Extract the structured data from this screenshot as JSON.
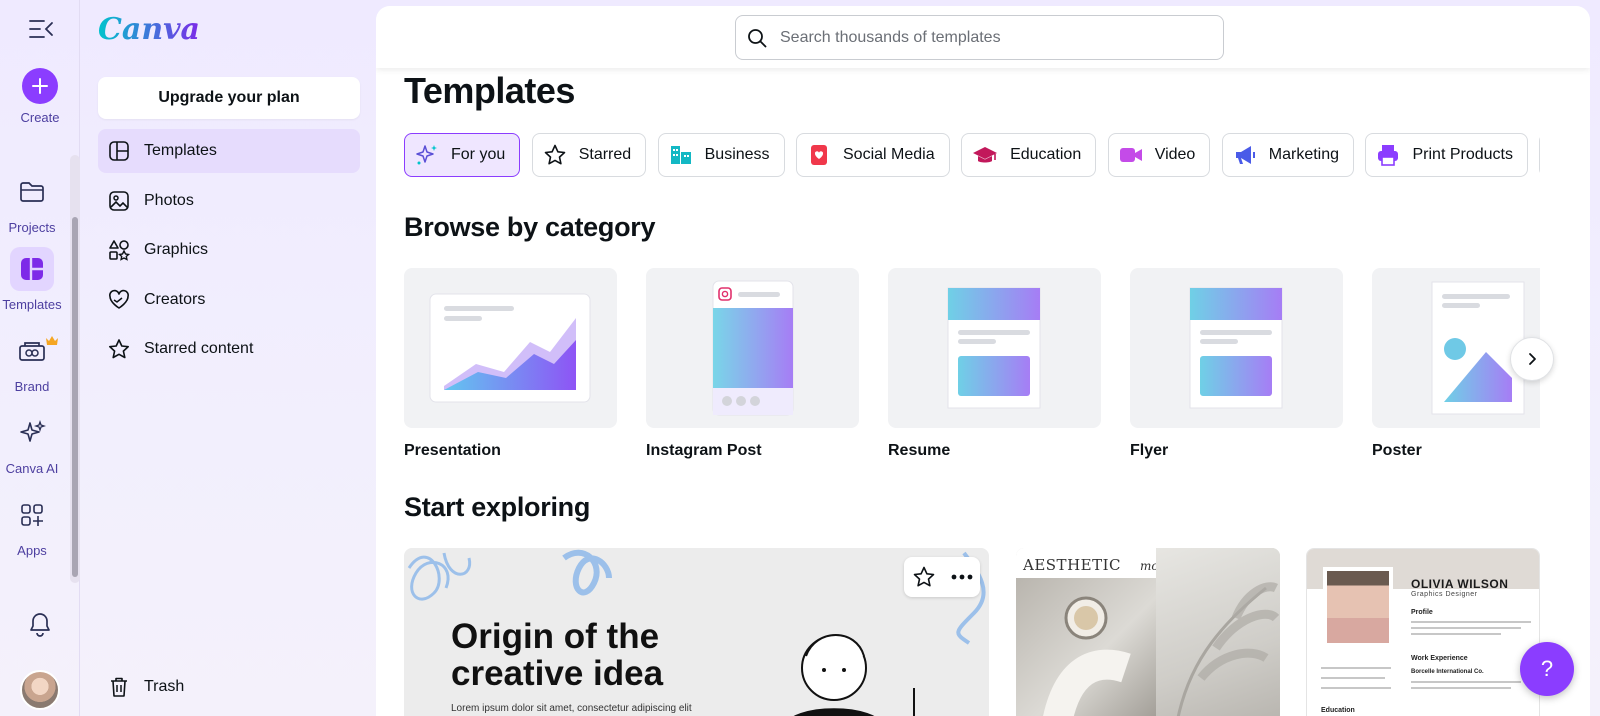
{
  "brand": {
    "logo_text": "Canva",
    "accent": "#8b3dff"
  },
  "rail": {
    "create_label": "Create",
    "items": [
      {
        "label": "Projects",
        "icon": "folder-icon"
      },
      {
        "label": "Templates",
        "icon": "templates-icon",
        "active": true
      },
      {
        "label": "Brand",
        "icon": "brand-icon",
        "badge": "crown-icon"
      },
      {
        "label": "Canva AI",
        "icon": "sparkle-icon"
      },
      {
        "label": "Apps",
        "icon": "apps-icon"
      }
    ]
  },
  "sidebar": {
    "upgrade_label": "Upgrade your plan",
    "items": [
      {
        "label": "Templates",
        "icon": "templates-icon",
        "active": true
      },
      {
        "label": "Photos",
        "icon": "photo-icon"
      },
      {
        "label": "Graphics",
        "icon": "graphics-icon"
      },
      {
        "label": "Creators",
        "icon": "heart-hands-icon"
      },
      {
        "label": "Starred content",
        "icon": "star-icon"
      }
    ],
    "trash_label": "Trash"
  },
  "search": {
    "placeholder": "Search thousands of templates"
  },
  "page": {
    "title": "Templates",
    "browse_heading": "Browse by category",
    "explore_heading": "Start exploring"
  },
  "chips": [
    {
      "label": "For you",
      "icon": "sparkle-icon",
      "active": true
    },
    {
      "label": "Starred",
      "icon": "star-icon"
    },
    {
      "label": "Business",
      "icon": "business-icon"
    },
    {
      "label": "Social Media",
      "icon": "heart-icon"
    },
    {
      "label": "Education",
      "icon": "graduation-cap-icon"
    },
    {
      "label": "Video",
      "icon": "video-icon"
    },
    {
      "label": "Marketing",
      "icon": "megaphone-icon"
    },
    {
      "label": "Print Products",
      "icon": "printer-icon"
    },
    {
      "label": "",
      "icon": "battery-icon"
    }
  ],
  "categories": [
    {
      "label": "Presentation"
    },
    {
      "label": "Instagram Post"
    },
    {
      "label": "Resume"
    },
    {
      "label": "Flyer"
    },
    {
      "label": "Poster"
    }
  ],
  "explore": {
    "card1": {
      "title_line1": "Origin of the",
      "title_line2": "creative idea",
      "subtitle": "Lorem ipsum dolor sit amet, consectetur adipiscing elit"
    },
    "card2": {
      "word1": "AESTHETIC",
      "word2": "mood"
    },
    "card3": {
      "name": "OLIVIA WILSON",
      "role": "Graphics Designer",
      "section1": "Profile",
      "section2": "Work Experience",
      "company": "Borcelle International Co.",
      "section3": "Education"
    }
  },
  "help_label": "?"
}
